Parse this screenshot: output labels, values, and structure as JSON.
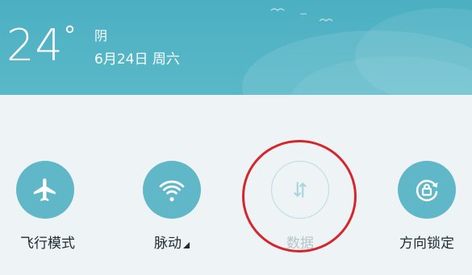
{
  "weather": {
    "temperature": "24",
    "unit": "°",
    "condition": "阴",
    "date": "6月24日 周六"
  },
  "toggles": [
    {
      "label": "飞行模式",
      "icon": "airplane-icon",
      "state": "on"
    },
    {
      "label": "脉动",
      "icon": "wifi-icon",
      "state": "on"
    },
    {
      "label": "数据",
      "icon": "data-arrows-icon",
      "state": "off"
    },
    {
      "label": "方向锁定",
      "icon": "rotation-lock-icon",
      "state": "on"
    }
  ],
  "colors": {
    "header": "#4cb0c2",
    "toggle_on": "#5fb7c7",
    "toggle_off_border": "#b9dde3",
    "highlight": "#d6262c",
    "background": "#eef3f6"
  }
}
